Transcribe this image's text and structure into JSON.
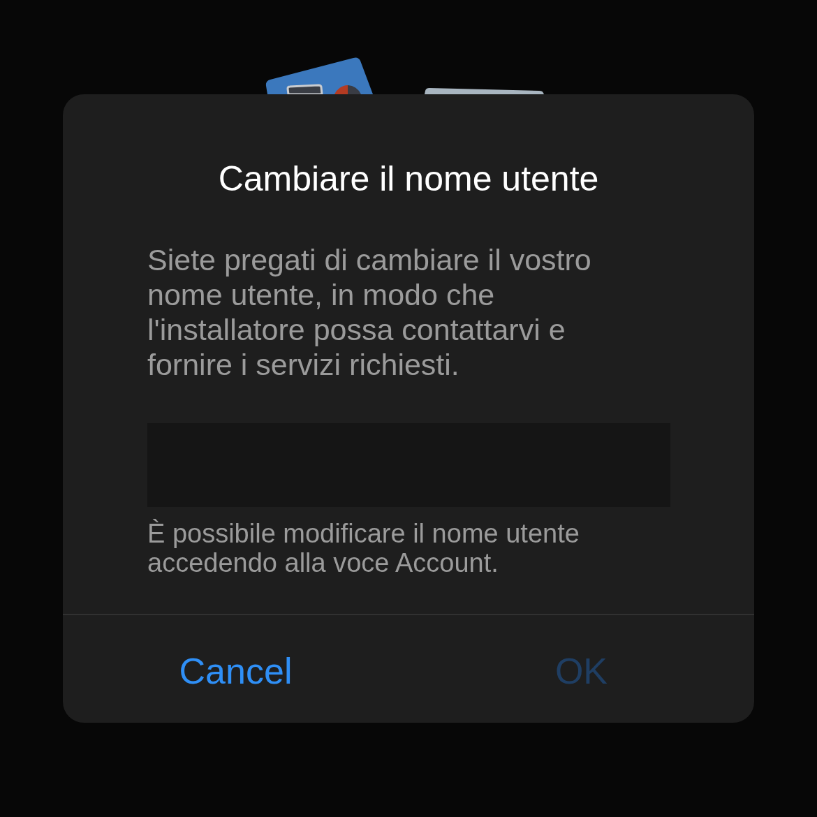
{
  "dialog": {
    "title": "Cambiare il nome utente",
    "message": "Siete pregati di cambiare il vostro nome utente, in modo che l'installatore possa contattarvi e fornire i servizi richiesti.",
    "hint": "È possibile modificare il nome utente accedendo alla voce Account.",
    "buttons": [
      {
        "label": "Cancel",
        "disabled": false
      },
      {
        "label": "OK",
        "disabled": true
      }
    ]
  }
}
